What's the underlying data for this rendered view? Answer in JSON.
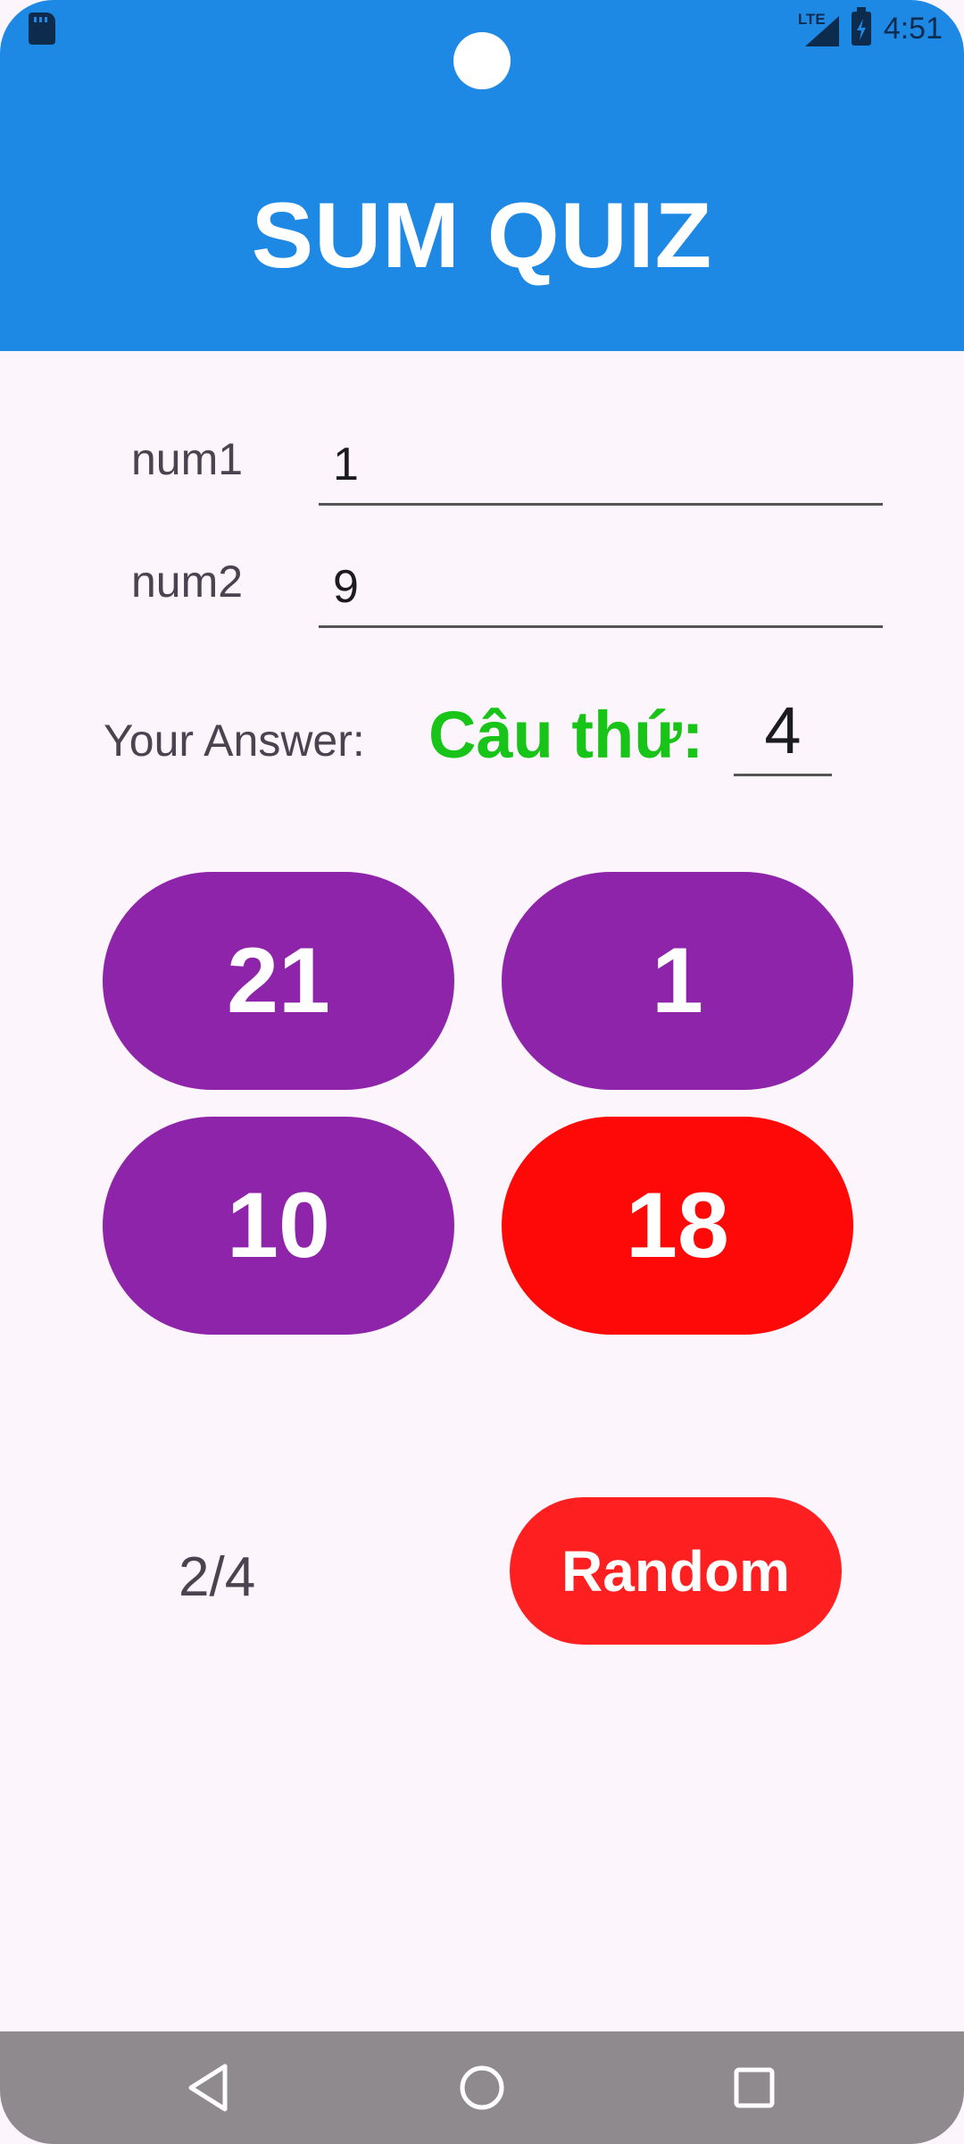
{
  "status_bar": {
    "time": "4:51",
    "network": "LTE",
    "icons": [
      "sd-card-icon",
      "lte-signal-icon",
      "battery-charging-icon"
    ]
  },
  "header": {
    "title": "SUM QUIZ",
    "color": "#1e88e5"
  },
  "form": {
    "num1_label": "num1",
    "num1_value": "1",
    "num2_label": "num2",
    "num2_value": "9"
  },
  "quiz": {
    "answer_label": "Your Answer:",
    "question_label": "Câu thứ:",
    "question_number": "4"
  },
  "options": [
    {
      "label": "21",
      "color": "#8e24aa"
    },
    {
      "label": "1",
      "color": "#8e24aa"
    },
    {
      "label": "10",
      "color": "#8e24aa"
    },
    {
      "label": "18",
      "color": "#ff0808"
    }
  ],
  "footer": {
    "progress": "2/4",
    "random_label": "Random",
    "random_color": "#fe2020"
  },
  "nav_bar": {
    "buttons": [
      "back-icon",
      "home-icon",
      "recents-icon"
    ]
  }
}
